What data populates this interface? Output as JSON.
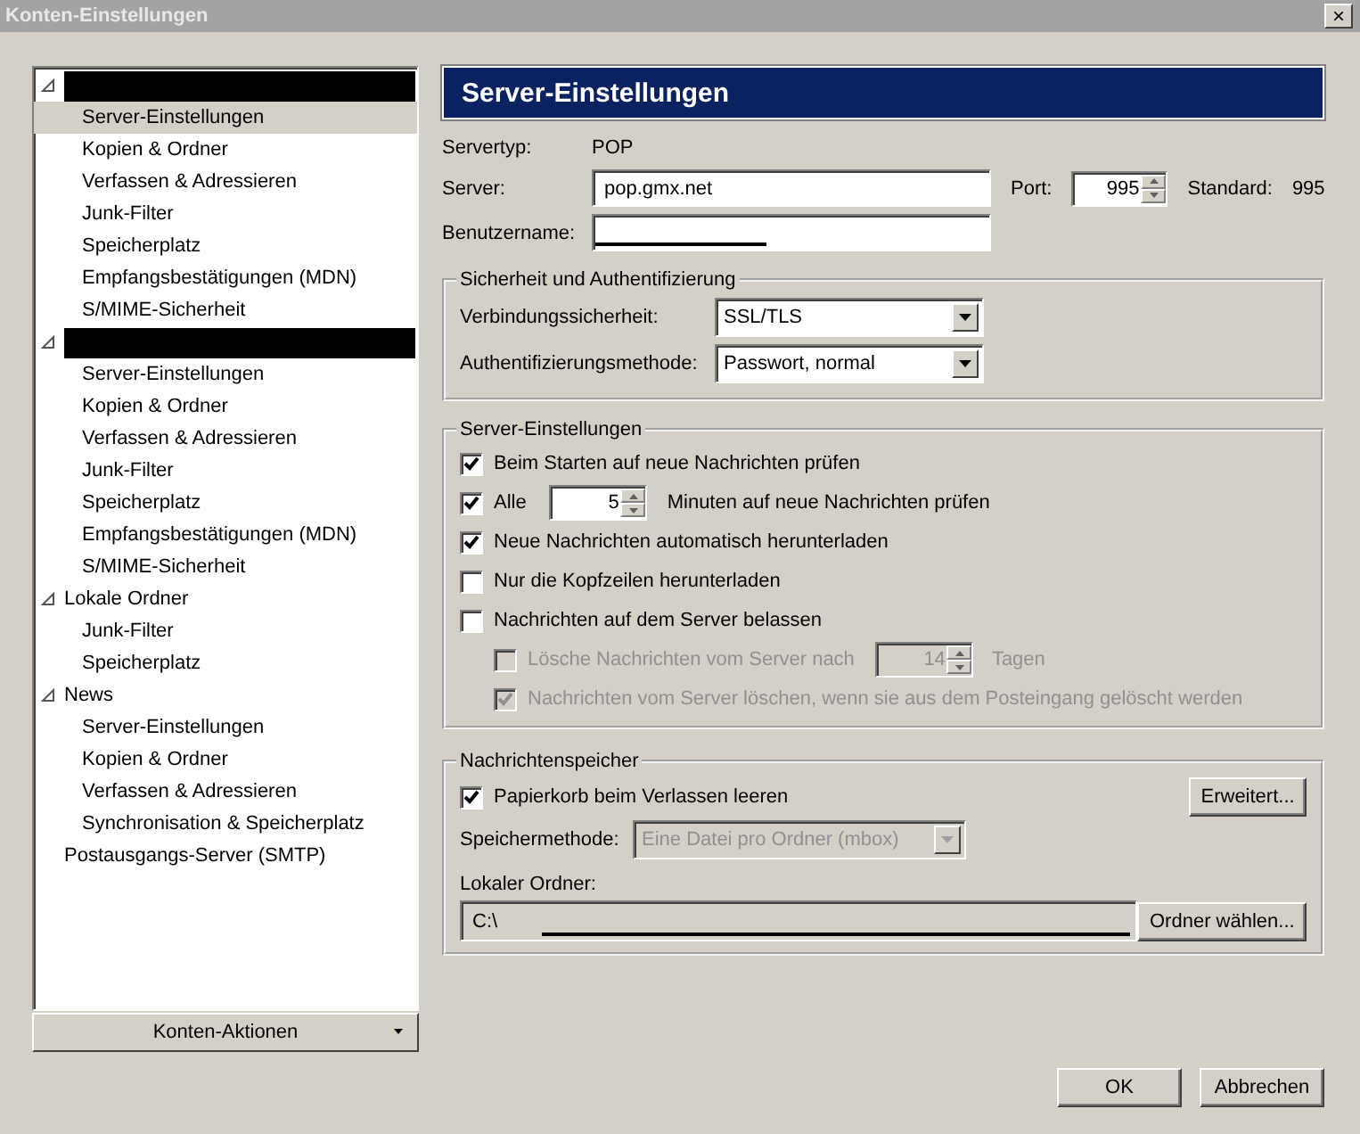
{
  "window": {
    "title": "Konten-Einstellungen",
    "close": "×"
  },
  "tree": [
    {
      "redacted": true,
      "expanded": true,
      "selected": false,
      "children": [
        {
          "label": "Server-Einstellungen",
          "selected": true
        },
        {
          "label": "Kopien & Ordner",
          "selected": false
        },
        {
          "label": "Verfassen & Adressieren",
          "selected": false
        },
        {
          "label": "Junk-Filter",
          "selected": false
        },
        {
          "label": "Speicherplatz",
          "selected": false
        },
        {
          "label": "Empfangsbestätigungen (MDN)",
          "selected": false
        },
        {
          "label": "S/MIME-Sicherheit",
          "selected": false
        }
      ]
    },
    {
      "redacted": true,
      "expanded": true,
      "selected": false,
      "children": [
        {
          "label": "Server-Einstellungen",
          "selected": false
        },
        {
          "label": "Kopien & Ordner",
          "selected": false
        },
        {
          "label": "Verfassen & Adressieren",
          "selected": false
        },
        {
          "label": "Junk-Filter",
          "selected": false
        },
        {
          "label": "Speicherplatz",
          "selected": false
        },
        {
          "label": "Empfangsbestätigungen (MDN)",
          "selected": false
        },
        {
          "label": "S/MIME-Sicherheit",
          "selected": false
        }
      ]
    },
    {
      "label": "Lokale Ordner",
      "expanded": true,
      "selected": false,
      "children": [
        {
          "label": "Junk-Filter",
          "selected": false
        },
        {
          "label": "Speicherplatz",
          "selected": false
        }
      ]
    },
    {
      "label": "News",
      "expanded": true,
      "selected": false,
      "children": [
        {
          "label": "Server-Einstellungen",
          "selected": false
        },
        {
          "label": "Kopien & Ordner",
          "selected": false
        },
        {
          "label": "Verfassen & Adressieren",
          "selected": false
        },
        {
          "label": "Synchronisation & Speicherplatz",
          "selected": false
        }
      ]
    },
    {
      "label": "Postausgangs-Server (SMTP)",
      "selected": false
    }
  ],
  "account_actions": "Konten-Aktionen",
  "header": "Server-Einstellungen",
  "server_type": {
    "label": "Servertyp:",
    "value": "POP"
  },
  "server": {
    "label": "Server:",
    "value": "pop.gmx.net"
  },
  "port": {
    "label": "Port:",
    "value": "995",
    "default_label": "Standard:",
    "default_value": "995"
  },
  "username": {
    "label": "Benutzername:",
    "redacted": true
  },
  "security": {
    "title": "Sicherheit und Authentifizierung",
    "fields": [
      {
        "label": "Verbindungssicherheit:",
        "value": "SSL/TLS"
      },
      {
        "label": "Authentifizierungsmethode:",
        "value": "Passwort, normal"
      }
    ]
  },
  "server_settings": {
    "title": "Server-Einstellungen",
    "options": [
      {
        "kind": "checkbox",
        "label": "Beim Starten auf neue Nachrichten prüfen",
        "checked": true,
        "disabled": false
      },
      {
        "kind": "interval",
        "label": "Alle",
        "value": "5",
        "suffix": "Minuten auf neue Nachrichten prüfen",
        "checked": true,
        "disabled": false
      },
      {
        "kind": "checkbox",
        "label": "Neue Nachrichten automatisch herunterladen",
        "checked": true,
        "disabled": false
      },
      {
        "kind": "checkbox",
        "label": "Nur die Kopfzeilen herunterladen",
        "checked": false,
        "disabled": false
      },
      {
        "kind": "checkbox",
        "label": "Nachrichten auf dem Server belassen",
        "checked": false,
        "disabled": false,
        "children": [
          {
            "kind": "interval",
            "label": "Lösche Nachrichten vom Server nach",
            "value": "14",
            "suffix": "Tagen",
            "checked": false,
            "disabled": true
          },
          {
            "kind": "checkbox",
            "label": "Nachrichten vom Server löschen, wenn sie aus dem Posteingang gelöscht werden",
            "checked": true,
            "disabled": true
          }
        ]
      }
    ]
  },
  "storage": {
    "title": "Nachrichtenspeicher",
    "empty_trash": {
      "label": "Papierkorb beim Verlassen leeren",
      "checked": true
    },
    "advanced_button": "Erweitert...",
    "method": {
      "label": "Speichermethode:",
      "value": "Eine Datei pro Ordner (mbox)",
      "disabled": true
    },
    "folder": {
      "label": "Lokaler Ordner:",
      "value": "C:\\",
      "redacted": true
    },
    "choose_button": "Ordner wählen..."
  },
  "buttons": [
    "OK",
    "Abbrechen"
  ]
}
